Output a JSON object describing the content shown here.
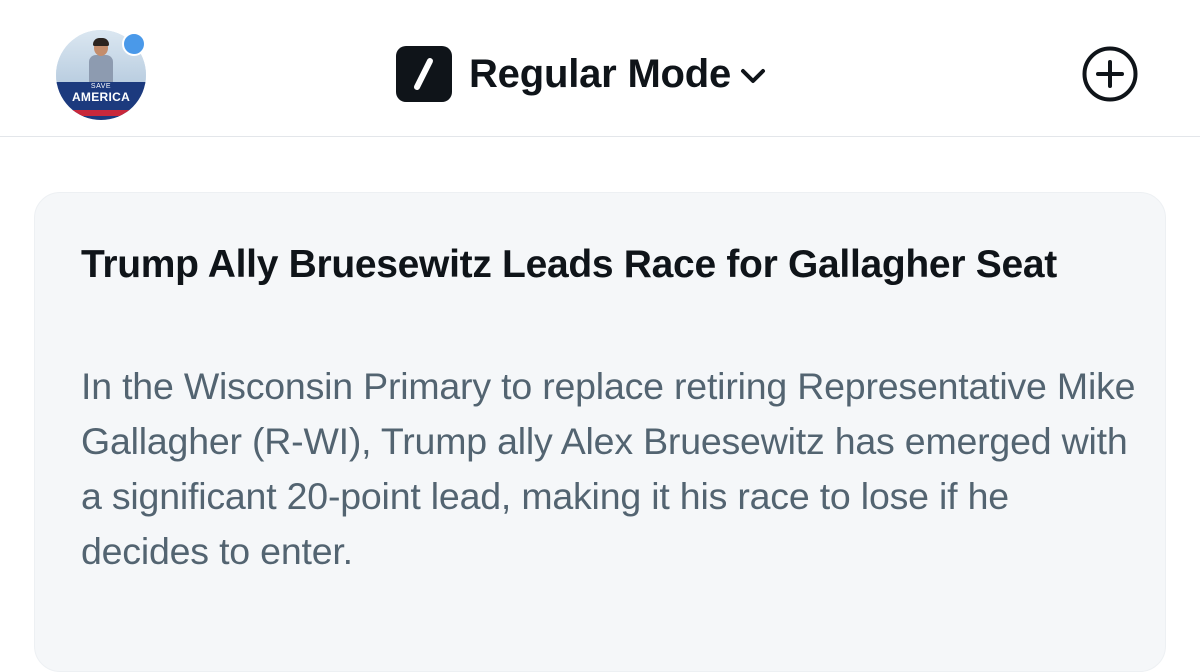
{
  "header": {
    "avatar": {
      "banner_small_text": "SAVE",
      "banner_text": "AMERICA",
      "has_notification": true
    },
    "mode_switch": {
      "label": "Regular Mode",
      "icon": "slash-icon",
      "dropdown_icon": "chevron-down-icon"
    },
    "actions": {
      "add_icon": "plus-circle-icon"
    }
  },
  "summary_card": {
    "title": "Trump Ally Bruesewitz Leads Race for Gallagher Seat",
    "body": "In the Wisconsin Primary to replace retiring Representative Mike Gallagher (R-WI), Trump ally Alex Bruesewitz has emerged with a significant 20-point lead, making it his race to lose if he decides to enter."
  },
  "colors": {
    "text_primary": "#0f1419",
    "text_secondary": "#536471",
    "card_background": "#f5f7f9",
    "notification_dot": "#4a99e9",
    "divider": "#e3e6ea"
  }
}
